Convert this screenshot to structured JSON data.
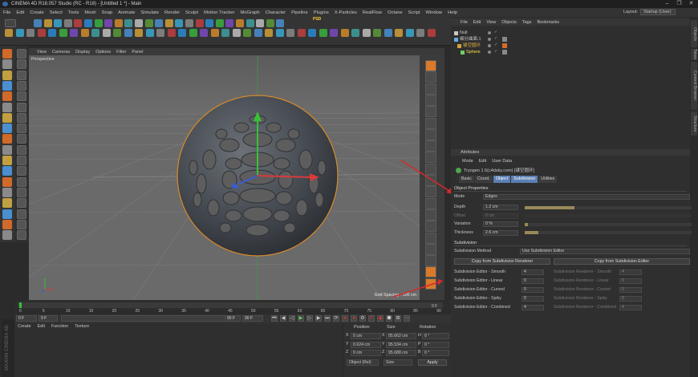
{
  "window": {
    "title": "CINEMA 4D R18.057 Studio (RC - R18) - [Untitled 1 *] - Main",
    "controls": [
      "–",
      "❐",
      "✕"
    ]
  },
  "menubar": [
    "File",
    "Edit",
    "Create",
    "Select",
    "Tools",
    "Mesh",
    "Snap",
    "Animate",
    "Simulate",
    "Render",
    "Sculpt",
    "Motion Tracker",
    "MoGraph",
    "Character",
    "Pipeline",
    "Plugins",
    "X-Particles",
    "RealFlow",
    "Octane",
    "Script",
    "Window",
    "Help"
  ],
  "layout": {
    "label": "Layout:",
    "value": "Startup (User)"
  },
  "toolbar": {
    "psd_badge": "PSD"
  },
  "viewport": {
    "menu": [
      "View",
      "Cameras",
      "Display",
      "Options",
      "Filter",
      "Panel"
    ],
    "camera_label": "Perspective",
    "grid_spacing": "Grid Spacing : 100 cm"
  },
  "timeline": {
    "ticks": [
      "0",
      "5",
      "10",
      "15",
      "20",
      "25",
      "30",
      "35",
      "40",
      "45",
      "50",
      "55",
      "60",
      "65",
      "70",
      "75",
      "80",
      "85",
      "90"
    ],
    "current_frame": "0 F",
    "start_field": "0 F",
    "preview_start": "0 F",
    "preview_end": "90 F",
    "end_field": "90 F"
  },
  "material_manager": {
    "menu": [
      "Create",
      "Edit",
      "Function",
      "Texture"
    ]
  },
  "maxon_logo": "MAXON CINEMA 4D",
  "coordinates": {
    "headers": [
      "Position",
      "Size",
      "Rotation"
    ],
    "rows": [
      {
        "axis": "X",
        "pos": "0 cm",
        "size_axis": "X",
        "size": "95.662 cm",
        "rot_axis": "H",
        "rot": "0 °"
      },
      {
        "axis": "Y",
        "pos": "0.624 cm",
        "size_axis": "Y",
        "size": "95.534 cm",
        "rot_axis": "P",
        "rot": "0 °"
      },
      {
        "axis": "Z",
        "pos": "0 cm",
        "size_axis": "Z",
        "size": "95.688 cm",
        "rot_axis": "B",
        "rot": "0 °"
      }
    ],
    "mode_select": "Object (Rel)",
    "size_select": "Size",
    "apply": "Apply"
  },
  "object_manager": {
    "menu": [
      "File",
      "Edit",
      "View",
      "Objects",
      "Tags",
      "Bookmarks"
    ],
    "objects": [
      {
        "name": "Null"
      },
      {
        "name": "细分曲面.1"
      },
      {
        "name": "镂空圆环"
      },
      {
        "name": "Sphere"
      }
    ]
  },
  "right_tabs": [
    "Objects",
    "Takes",
    "Content Browser",
    "Structure"
  ],
  "attributes": {
    "title": "Attributes",
    "menu": [
      "Mode",
      "Edit",
      "User Data"
    ],
    "object_name": "Tryogen 1.5(c4dsky.com) [镂空圆环]",
    "tabs": [
      {
        "label": "Basic",
        "active": false
      },
      {
        "label": "Coord.",
        "active": false
      },
      {
        "label": "Object",
        "active": true
      },
      {
        "label": "Subdivision",
        "active": true
      },
      {
        "label": "Utilities",
        "active": false
      }
    ],
    "section_object": "Object Properties",
    "mode": {
      "label": "Mode",
      "value": "Edges"
    },
    "props": [
      {
        "label": "Depth",
        "value": "1.2 cm",
        "fill": 0.3,
        "enabled": true
      },
      {
        "label": "Offset",
        "value": "0 cm",
        "fill": 0,
        "enabled": false
      },
      {
        "label": "Variation",
        "value": "0 %",
        "fill": 0.02,
        "enabled": true
      },
      {
        "label": "Thickness",
        "value": "2.6 cm",
        "fill": 0.08,
        "enabled": true
      }
    ],
    "section_subdivision": "Subdivision",
    "subdivision_method": {
      "label": "Subdivision Method",
      "value": "Use Subdivision Editor"
    },
    "copy_renderer_btn": "Copy from Subdivision Renderer",
    "copy_editor_btn": "Copy from Subdivision Editor",
    "subdivision_rows": [
      {
        "left": "Subdivision Editor - Smooth",
        "left_val": "4",
        "right": "Subdivision Renderer - Smooth",
        "right_val": "4"
      },
      {
        "left": "Subdivision Editor - Linear",
        "left_val": "0",
        "right": "Subdivision Renderer - Linear",
        "right_val": "0"
      },
      {
        "left": "Subdivision Editor - Curved",
        "left_val": "0",
        "right": "Subdivision Renderer - Curved",
        "right_val": "0"
      },
      {
        "left": "Subdivision Editor - Spiky",
        "left_val": "0",
        "right": "Subdivision Renderer - Spiky",
        "right_val": "0"
      },
      {
        "left": "Subdivision Editor - Combined",
        "left_val": "4",
        "right": "Subdivision Renderer - Combined",
        "right_val": "4"
      }
    ]
  }
}
